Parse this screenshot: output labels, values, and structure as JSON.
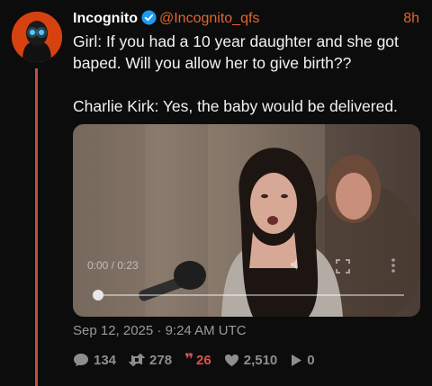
{
  "author": {
    "name": "Incognito",
    "handle": "@Incognito_qfs",
    "time": "8h",
    "verified": true
  },
  "tweet": {
    "line1": "Girl: If you had a 10 year daughter and she got baped. Will you allow her to give birth??",
    "line2": "Charlie Kirk: Yes, the baby would be delivered."
  },
  "video": {
    "time_display": "0:00 / 0:23",
    "progress": 0
  },
  "meta": {
    "datetime": "Sep 12, 2025 · 9:24 AM UTC"
  },
  "stats": {
    "replies": "134",
    "retweets": "278",
    "quotes": "26",
    "likes": "2,510",
    "views": "0"
  },
  "colors": {
    "accent": "#e0662f",
    "quote": "#e0514a",
    "thread_line": "#c44d3f",
    "avatar_bg": "#d6420f",
    "background": "#0c0c0c"
  },
  "icons": [
    "avatar-icon",
    "verified-badge-icon",
    "reply-icon",
    "retweet-icon",
    "quote-icon",
    "heart-icon",
    "play-icon",
    "fullscreen-icon"
  ]
}
